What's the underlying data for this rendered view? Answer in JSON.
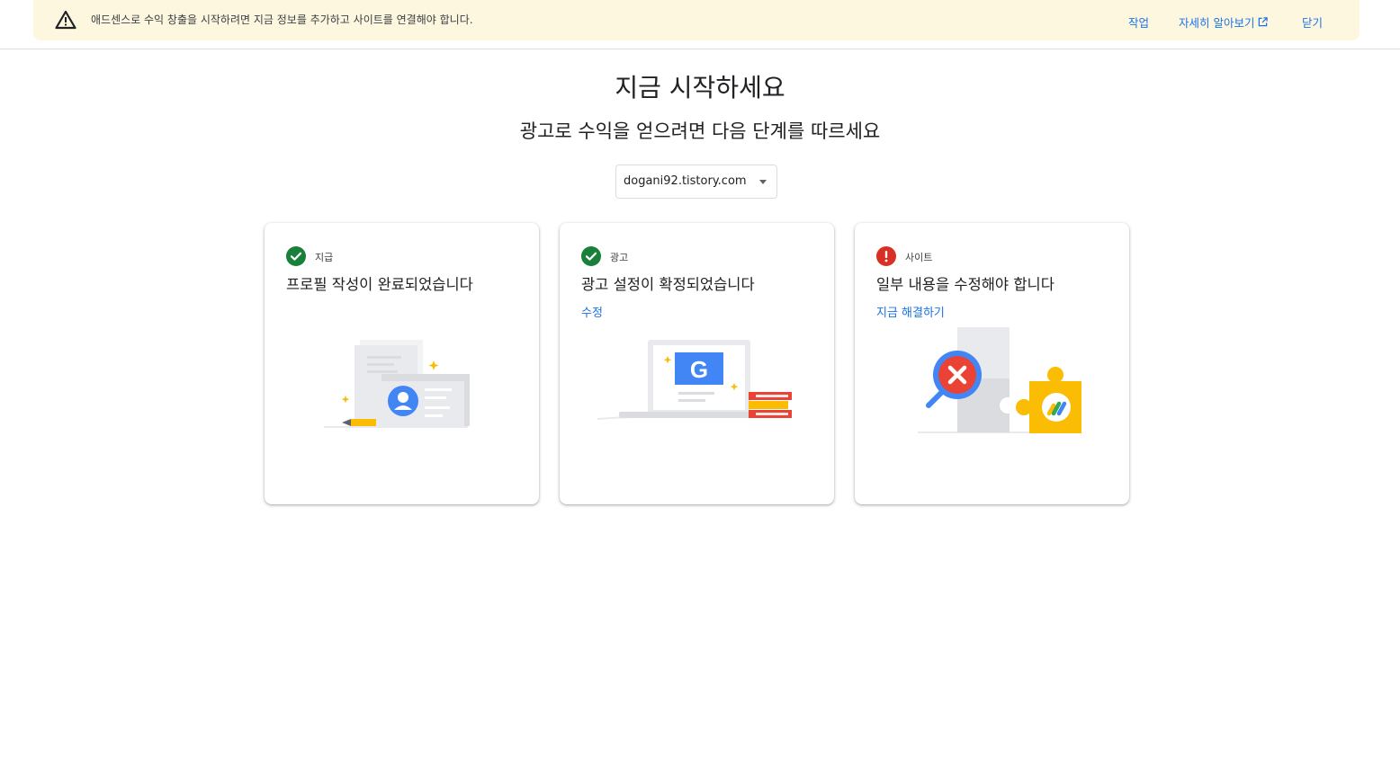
{
  "banner": {
    "message": "애드센스로 수익 창출을 시작하려면 지금 정보를 추가하고 사이트를 연결해야 합니다.",
    "action_link": "작업",
    "learn_more_link": "자세히 알아보기",
    "close_link": "닫기",
    "warning_color": "#202124"
  },
  "main": {
    "title": "지금 시작하세요",
    "subtitle": "광고로 수익을 얻으려면 다음 단계를 따르세요",
    "site_selector": {
      "value": "dogani92.tistory.com"
    }
  },
  "cards": [
    {
      "category": "지급",
      "title": "프로필 작성이 완료되었습니다",
      "link": "",
      "status": "complete",
      "status_color": "#188038",
      "illustration": "profile-card-illustration"
    },
    {
      "category": "광고",
      "title": "광고 설정이 확정되었습니다",
      "link": "수정",
      "status": "complete",
      "status_color": "#188038",
      "illustration": "google-laptop-illustration"
    },
    {
      "category": "사이트",
      "title": "일부 내용을 수정해야 합니다",
      "link": "지금 해결하기",
      "status": "error",
      "status_color": "#d93025",
      "illustration": "magnifier-puzzle-illustration"
    }
  ],
  "colors": {
    "link": "#1a73e8",
    "banner_bg": "#fef7e0",
    "google_blue": "#4285f4",
    "google_yellow": "#fbbc04",
    "google_red": "#ea4335"
  }
}
